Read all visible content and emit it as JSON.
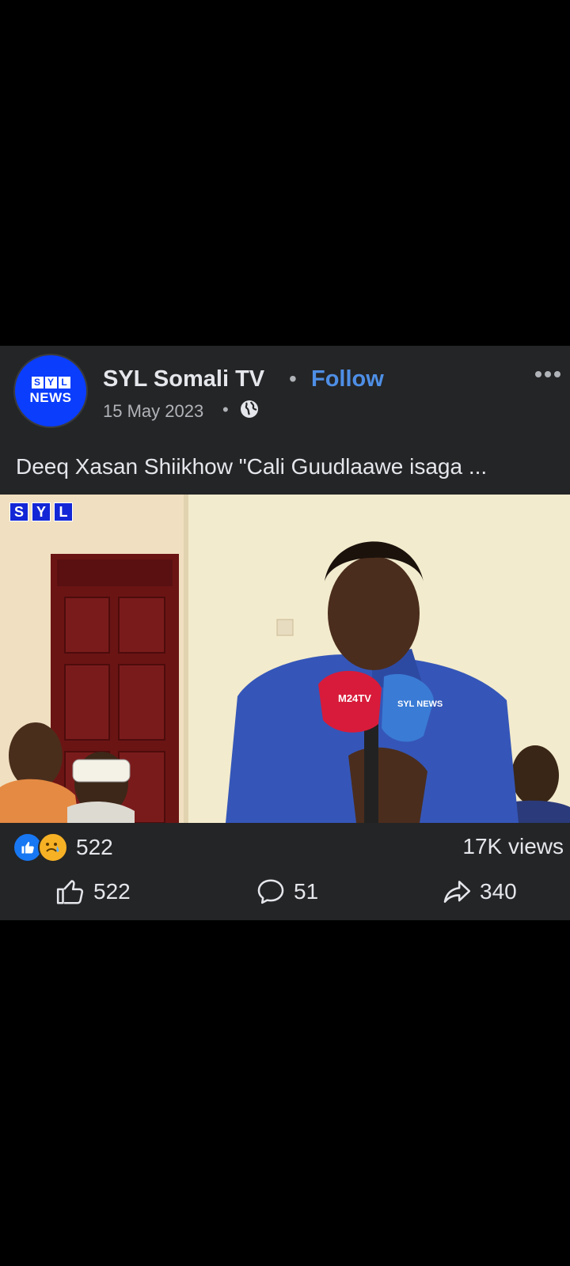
{
  "post": {
    "page_name": "SYL Somali TV",
    "separator": "•",
    "follow_label": "Follow",
    "date": "15 May 2023",
    "privacy_icon": "globe-icon",
    "avatar": {
      "letters": [
        "S",
        "Y",
        "L"
      ],
      "word": "NEWS"
    },
    "caption": "Deeq Xasan Shiikhow \"Cali Guudlaawe isaga ...",
    "video": {
      "watermark_letters": [
        "S",
        "Y",
        "L"
      ],
      "mic_labels": [
        "M24TV",
        "SYL NEWS"
      ]
    },
    "reactions": {
      "count": "522",
      "types": [
        "like",
        "sad"
      ]
    },
    "views": "17K views",
    "actions": {
      "like_count": "522",
      "comment_count": "51",
      "share_count": "340"
    }
  },
  "colors": {
    "card_bg": "#242526",
    "follow": "#4e8fe6",
    "brand_blue": "#0a3dfc",
    "mic_red": "#d81b3a"
  }
}
